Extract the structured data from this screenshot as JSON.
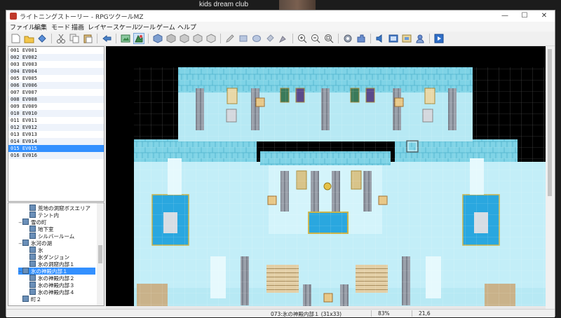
{
  "zoom": {
    "participant_name": "kids dream club"
  },
  "window": {
    "title": "ライトニングストーリー - RPGツクールMZ",
    "controls": [
      "—",
      "☐",
      "✕"
    ]
  },
  "menu": [
    "ファイル",
    "編集",
    "モード",
    "描画",
    "レイヤー",
    "スケール",
    "ツール",
    "ゲーム",
    "ヘルプ"
  ],
  "toolbar": {
    "icons": [
      "new-project-icon",
      "open-project-icon",
      "save-project-icon",
      "cut-icon",
      "copy-icon",
      "paste-icon",
      "undo-icon",
      "map-mode-icon",
      "event-mode-icon",
      "layer-1-icon",
      "layer-2-icon",
      "layer-3-icon",
      "layer-4-icon",
      "region-layer-icon",
      "pencil-icon",
      "rectangle-icon",
      "ellipse-icon",
      "flood-fill-icon",
      "shadow-pen-icon",
      "zoom-in-icon",
      "zoom-out-icon",
      "zoom-actual-icon",
      "database-icon",
      "plugin-manager-icon",
      "sound-test-icon",
      "event-searcher-icon",
      "resource-manager-icon",
      "character-generator-icon",
      "playtest-icon"
    ]
  },
  "events": [
    {
      "id": "001",
      "name": "EV001"
    },
    {
      "id": "002",
      "name": "EV002"
    },
    {
      "id": "003",
      "name": "EV003"
    },
    {
      "id": "004",
      "name": "EV004"
    },
    {
      "id": "005",
      "name": "EV005"
    },
    {
      "id": "006",
      "name": "EV006"
    },
    {
      "id": "007",
      "name": "EV007"
    },
    {
      "id": "008",
      "name": "EV008"
    },
    {
      "id": "009",
      "name": "EV009"
    },
    {
      "id": "010",
      "name": "EV010"
    },
    {
      "id": "011",
      "name": "EV011"
    },
    {
      "id": "012",
      "name": "EV012"
    },
    {
      "id": "013",
      "name": "EV013"
    },
    {
      "id": "014",
      "name": "EV014"
    },
    {
      "id": "015",
      "name": "EV015"
    },
    {
      "id": "016",
      "name": "EV016"
    }
  ],
  "selected_event_index": 14,
  "map_tree": [
    {
      "label": "荒地の洞窟ボスエリア",
      "level": 2,
      "expander": ""
    },
    {
      "label": "テント内",
      "level": 2,
      "expander": ""
    },
    {
      "label": "雪の町",
      "level": 1,
      "expander": "−"
    },
    {
      "label": "地下室",
      "level": 2,
      "expander": ""
    },
    {
      "label": "シルバールーム",
      "level": 2,
      "expander": ""
    },
    {
      "label": "氷河の湖",
      "level": 1,
      "expander": "−"
    },
    {
      "label": "氷",
      "level": 2,
      "expander": ""
    },
    {
      "label": "氷ダンジョン",
      "level": 2,
      "expander": ""
    },
    {
      "label": "氷の洞窟内部１",
      "level": 2,
      "expander": ""
    },
    {
      "label": "氷の神殿内部１",
      "level": 1,
      "expander": "−",
      "selected": true
    },
    {
      "label": "氷の神殿内部２",
      "level": 2,
      "expander": ""
    },
    {
      "label": "氷の神殿内部３",
      "level": 2,
      "expander": ""
    },
    {
      "label": "氷の神殿内部４",
      "level": 2,
      "expander": ""
    },
    {
      "label": "町２",
      "level": 1,
      "expander": ""
    }
  ],
  "status": {
    "map_info": "073:氷の神殿内部１ (31x33)",
    "zoom": "83%",
    "coords": "21,6"
  },
  "colors": {
    "ice_floor": "#b7e9f4",
    "ice_wall": "#5fc8dd",
    "water": "#2aa7df",
    "stone_pillar": "#8f95a0",
    "stair": "#d8c39a",
    "selection": "#3390ff"
  }
}
